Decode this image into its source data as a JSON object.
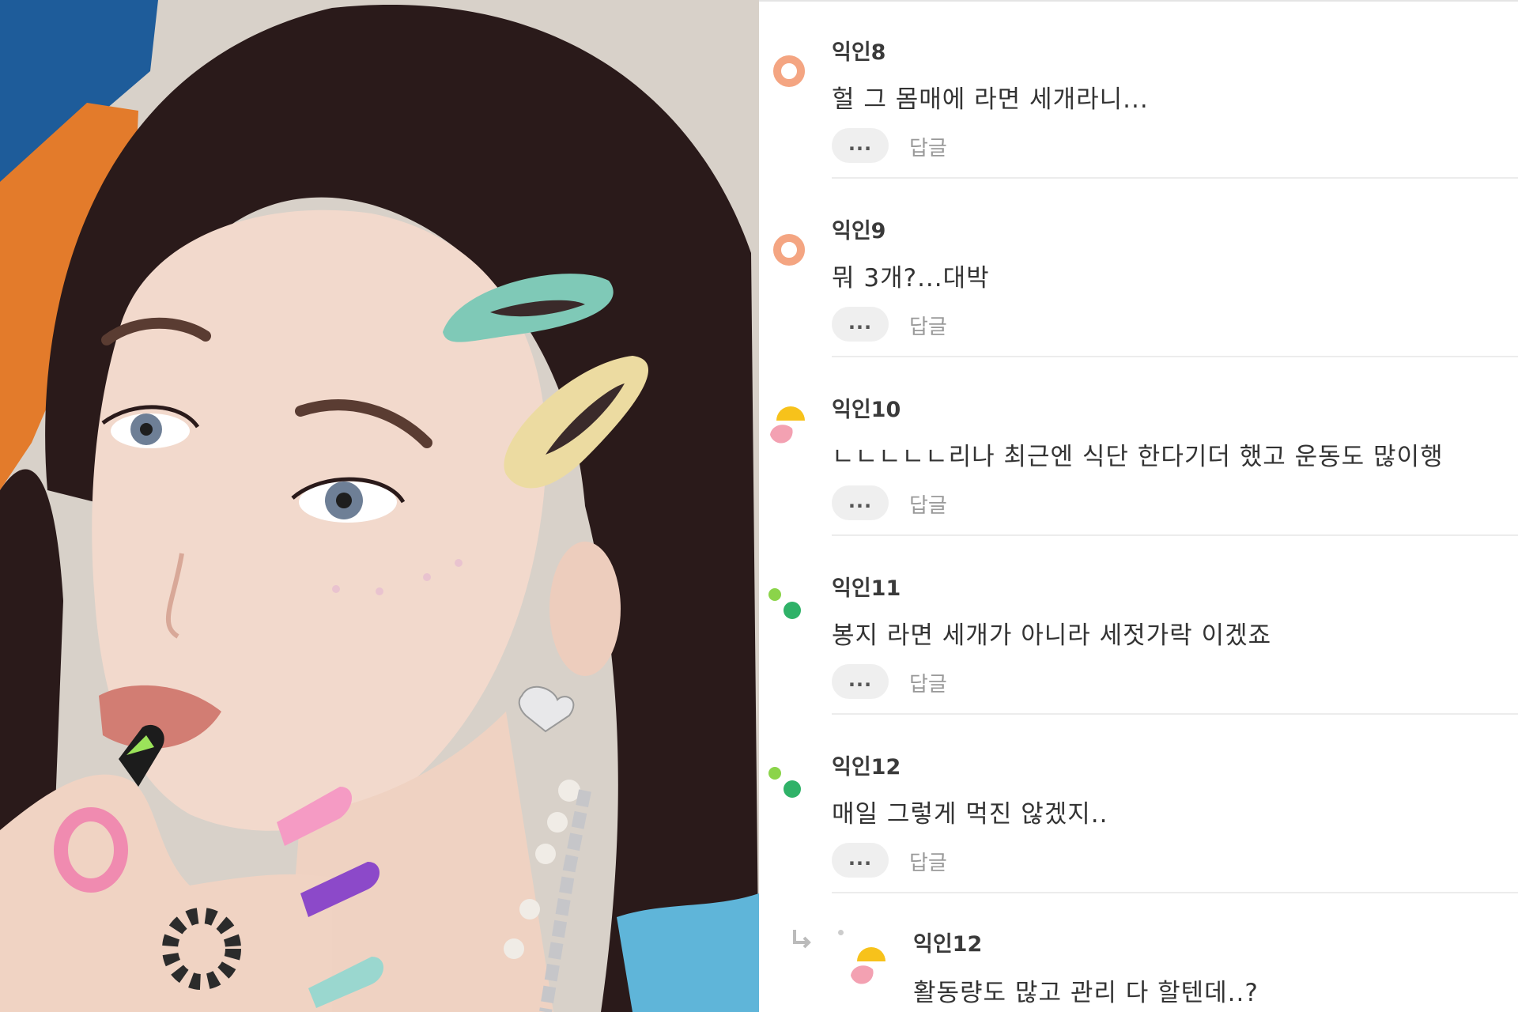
{
  "photo": {
    "alt_subject": "portrait"
  },
  "comments": [
    {
      "author": "익인8",
      "text": "헐 그 몸매에 라면 세개라니...",
      "avatar_icon": "orange-ring-avatar-icon",
      "more_label": "...",
      "reply_label": "답글"
    },
    {
      "author": "익인9",
      "text": "뭐 3개?...대박",
      "avatar_icon": "orange-ring-avatar-icon",
      "more_label": "...",
      "reply_label": "답글"
    },
    {
      "author": "익인10",
      "text": "ㄴㄴㄴㄴㄴ리나 최근엔 식단 한다기더 했고 운동도 많이행",
      "avatar_icon": "yellow-pink-avatar-icon",
      "more_label": "...",
      "reply_label": "답글"
    },
    {
      "author": "익인11",
      "text": "봉지 라면 세개가 아니라 세젓가락 이겠죠",
      "avatar_icon": "green-dots-avatar-icon",
      "more_label": "...",
      "reply_label": "답글"
    },
    {
      "author": "익인12",
      "text": "매일 그렇게 먹진 않겠지..",
      "avatar_icon": "green-dots-avatar-icon",
      "more_label": "...",
      "reply_label": "답글"
    }
  ],
  "nested_reply": {
    "author": "익인12",
    "text": "활동량도 많고 관리 다 할텐데..?",
    "arrow_icon": "reply-arrow-icon",
    "avatar_icon": "yellow-pink-avatar-icon"
  },
  "colors": {
    "orange_avatar": "#f4a582",
    "yellow_avatar": "#f7c21b",
    "pink_avatar": "#f3a1b2",
    "green_avatar": "#2fb268",
    "green_light": "#8bd44a"
  }
}
